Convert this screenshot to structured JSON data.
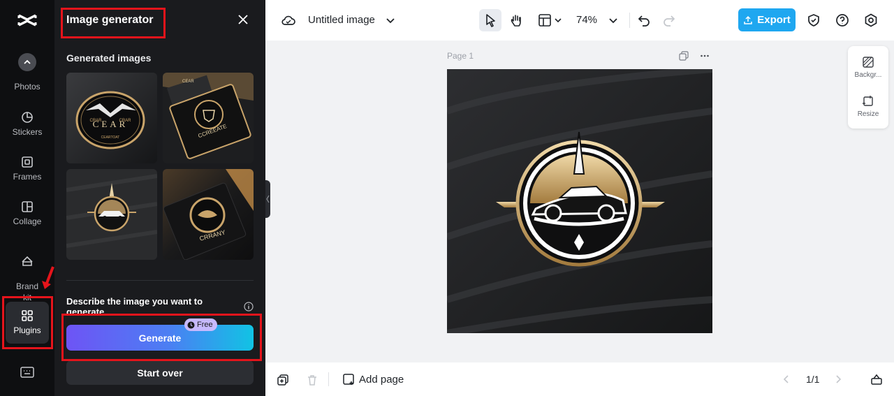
{
  "rail": {
    "items": [
      {
        "label": "Photos"
      },
      {
        "label": "Stickers"
      },
      {
        "label": "Frames"
      },
      {
        "label": "Collage"
      },
      {
        "label": "Brand\nkit"
      },
      {
        "label": "Plugins"
      }
    ]
  },
  "panel": {
    "title": "Image generator",
    "section_label": "Generated images",
    "describe_label": "Describe the image you want to generate",
    "generate_label": "Generate",
    "free_badge": "Free",
    "start_over_label": "Start over",
    "thumbnails": [
      {
        "texts": [
          "CEAR",
          "CRAR",
          "CRAR",
          "CEARTOAT"
        ]
      },
      {
        "texts": [
          "CCREEATE",
          "CEAR"
        ]
      },
      {
        "texts": []
      },
      {
        "texts": [
          "CRRANY"
        ]
      }
    ]
  },
  "topbar": {
    "doc_title": "Untitled image",
    "zoom": "74%",
    "export_label": "Export"
  },
  "canvas": {
    "page_label": "Page 1"
  },
  "side_tools": [
    {
      "label": "Backgr..."
    },
    {
      "label": "Resize"
    }
  ],
  "bottombar": {
    "add_page_label": "Add page",
    "pager": "1/1"
  },
  "colors": {
    "accent": "#1fa7f0",
    "highlight": "#e5141b",
    "generate_gradient_start": "#6e54f5",
    "generate_gradient_end": "#11c3e4"
  }
}
